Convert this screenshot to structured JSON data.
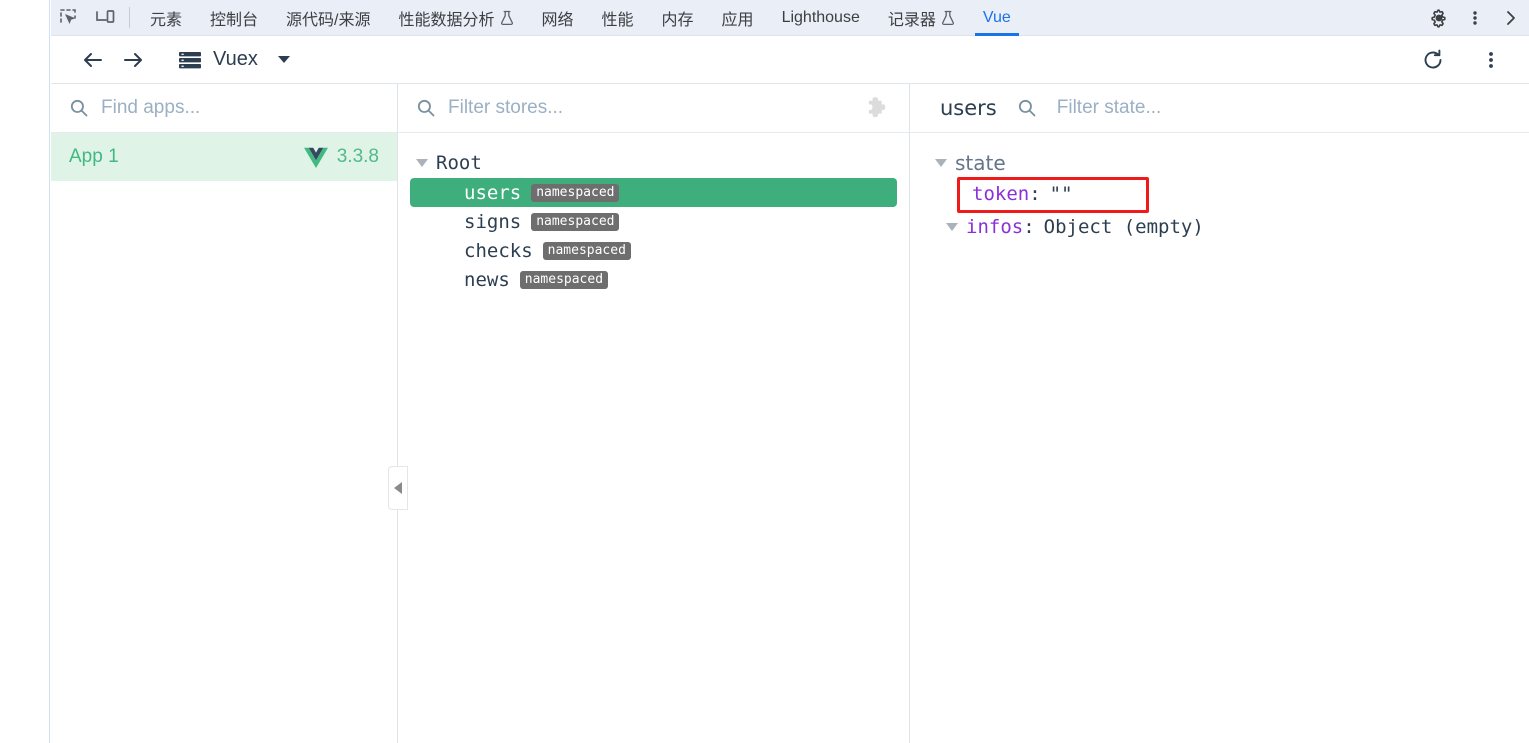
{
  "devtools_tabbar": {
    "icons": [
      {
        "name": "inspect-element-icon"
      },
      {
        "name": "device-toolbar-icon"
      }
    ],
    "tabs": [
      {
        "label": "元素",
        "flask": false,
        "active": false
      },
      {
        "label": "控制台",
        "flask": false,
        "active": false
      },
      {
        "label": "源代码/来源",
        "flask": false,
        "active": false
      },
      {
        "label": "性能数据分析",
        "flask": true,
        "active": false
      },
      {
        "label": "网络",
        "flask": false,
        "active": false
      },
      {
        "label": "性能",
        "flask": false,
        "active": false
      },
      {
        "label": "内存",
        "flask": false,
        "active": false
      },
      {
        "label": "应用",
        "flask": false,
        "active": false
      },
      {
        "label": "Lighthouse",
        "flask": false,
        "active": false
      },
      {
        "label": "记录器",
        "flask": true,
        "active": false
      },
      {
        "label": "Vue",
        "flask": false,
        "active": true
      }
    ],
    "right_icons": [
      {
        "name": "settings-gear-icon"
      },
      {
        "name": "more-options-icon"
      },
      {
        "name": "close-devtools-icon"
      }
    ],
    "active_tab_color": "#1a73e8",
    "background": "#eaeef6"
  },
  "vue_toolbar": {
    "back_icon": "arrow-left-icon",
    "forward_icon": "arrow-right-icon",
    "store_icon": "stacked-bars-icon",
    "store_label": "Vuex",
    "dropdown_icon": "chevron-down-icon",
    "refresh_icon": "refresh-icon",
    "more_icon": "more-options-icon"
  },
  "apps_panel": {
    "search": {
      "placeholder": "Find apps...",
      "value": "",
      "icon": "search-icon"
    },
    "apps": [
      {
        "name": "App 1",
        "version": "3.3.8",
        "logo": "vue-logo-icon",
        "selected": true
      }
    ],
    "selected_bg": "#dff3e6",
    "accent": "#42b883",
    "collapse_handle_icon": "triangle-left-icon"
  },
  "stores_panel": {
    "search": {
      "placeholder": "Filter stores...",
      "value": "",
      "icon": "search-icon"
    },
    "plugin_icon": "puzzle-piece-icon",
    "tree": {
      "root_label": "Root",
      "root_expanded": true,
      "items": [
        {
          "label": "users",
          "badge": "namespaced",
          "selected": true
        },
        {
          "label": "signs",
          "badge": "namespaced",
          "selected": false
        },
        {
          "label": "checks",
          "badge": "namespaced",
          "selected": false
        },
        {
          "label": "news",
          "badge": "namespaced",
          "selected": false
        }
      ]
    },
    "selected_color": "#3eaf7c"
  },
  "state_panel": {
    "title": "users",
    "search": {
      "placeholder": "Filter state...",
      "value": "",
      "icon": "search-icon"
    },
    "section_label": "state",
    "section_expanded": true,
    "properties": [
      {
        "key": "token",
        "separator": ":",
        "value": "\"\"",
        "expandable": false,
        "highlighted": true
      },
      {
        "key": "infos",
        "separator": ":",
        "value": "Object (empty)",
        "expandable": true,
        "highlighted": false
      }
    ],
    "highlight_color": "#f01a1a",
    "key_color": "#8b2fd8"
  }
}
